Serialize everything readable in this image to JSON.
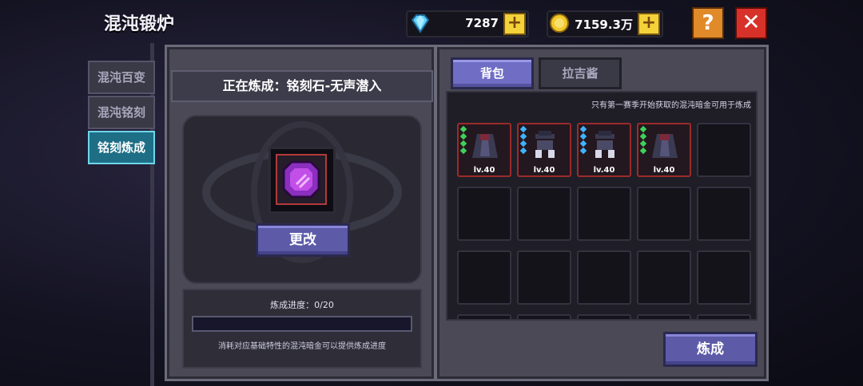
{
  "title": "混沌锻炉",
  "resources": {
    "gems": "7287",
    "gold": "7159.3万",
    "plus": "+"
  },
  "top_buttons": {
    "help": "?",
    "close": "✕"
  },
  "side_tabs": [
    {
      "label": "混沌百变",
      "active": false
    },
    {
      "label": "混沌铭刻",
      "active": false
    },
    {
      "label": "铭刻炼成",
      "active": true
    }
  ],
  "left_panel": {
    "header": "正在炼成：铭刻石-无声潜入",
    "change_button": "更改",
    "progress_label": "炼成进度：0/20",
    "progress_fraction": 0,
    "hint": "消耗对应基础特性的混沌暗金可以提供炼成进度"
  },
  "right_panel": {
    "tabs": [
      {
        "label": "背包",
        "active": true
      },
      {
        "label": "拉吉酱",
        "active": false
      }
    ],
    "note": "只有第一赛季开始获取的混沌暗金可用于炼成",
    "items": [
      {
        "level": "lv.40",
        "icon": "armor-cloak-icon",
        "pip_color": "#3fd15a"
      },
      {
        "level": "lv.40",
        "icon": "hat-armor-icon",
        "pip_color": "#3fb4ff"
      },
      {
        "level": "lv.40",
        "icon": "hat-armor-icon",
        "pip_color": "#3fb4ff"
      },
      {
        "level": "lv.40",
        "icon": "armor-cloak-icon",
        "pip_color": "#3fd15a"
      }
    ],
    "forge_button": "炼成"
  },
  "colors": {
    "accent": "#6f6dc4",
    "active_tab": "#1e6f86",
    "item_border": "#9c2a2a"
  }
}
